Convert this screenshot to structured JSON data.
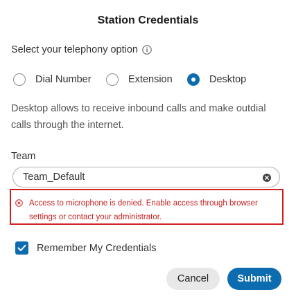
{
  "dialog": {
    "title": "Station Credentials"
  },
  "telephony": {
    "label": "Select your telephony option",
    "info_icon": "info-circle-icon",
    "options": [
      {
        "label": "Dial Number",
        "selected": false
      },
      {
        "label": "Extension",
        "selected": false
      },
      {
        "label": "Desktop",
        "selected": true
      }
    ],
    "description": "Desktop allows to receive inbound calls and make outdial calls through the internet."
  },
  "team": {
    "label": "Team",
    "value": "Team_Default",
    "clear_icon": "clear-circle-icon"
  },
  "error": {
    "icon": "error-circle-icon",
    "message": "Access to microphone is denied. Enable access through browser settings or contact your administrator."
  },
  "remember": {
    "label": "Remember My Credentials",
    "checked": true
  },
  "actions": {
    "cancel_label": "Cancel",
    "submit_label": "Submit"
  },
  "colors": {
    "accent": "#0d6bb0",
    "error": "#d11f1f"
  }
}
